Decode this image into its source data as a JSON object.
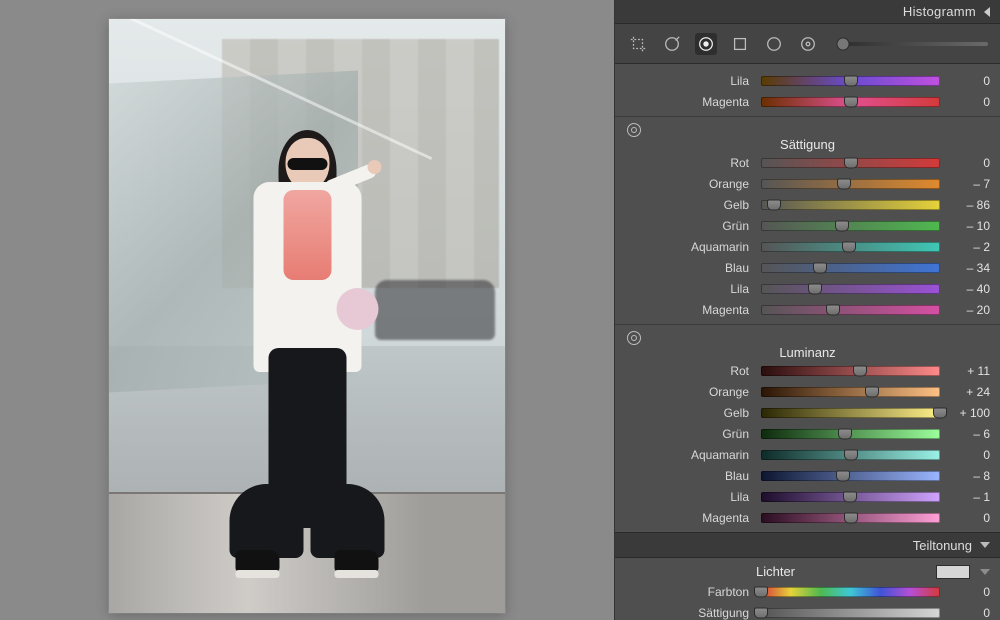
{
  "header": {
    "histogram": "Histogramm"
  },
  "top_group": {
    "rows": [
      {
        "key": "lila",
        "label": "Lila",
        "value": 0,
        "grad": [
          "#5a3c00",
          "#6a4cd0",
          "#c050e0"
        ]
      },
      {
        "key": "magenta",
        "label": "Magenta",
        "value": 0,
        "grad": [
          "#6a2f00",
          "#e05090",
          "#d43a3a"
        ]
      }
    ]
  },
  "saturation": {
    "title": "Sättigung",
    "rows": [
      {
        "key": "rot",
        "label": "Rot",
        "value": 0,
        "grad": [
          "#555",
          "#d43a3a"
        ]
      },
      {
        "key": "orange",
        "label": "Orange",
        "value": -7,
        "grad": [
          "#555",
          "#e08a2e"
        ]
      },
      {
        "key": "gelb",
        "label": "Gelb",
        "value": -86,
        "grad": [
          "#555",
          "#e6d23a"
        ]
      },
      {
        "key": "gruen",
        "label": "Grün",
        "value": -10,
        "grad": [
          "#555",
          "#4fb94f"
        ]
      },
      {
        "key": "aquamarin",
        "label": "Aquamarin",
        "value": -2,
        "grad": [
          "#555",
          "#3fc7b6"
        ]
      },
      {
        "key": "blau",
        "label": "Blau",
        "value": -34,
        "grad": [
          "#555",
          "#3f74d6"
        ]
      },
      {
        "key": "lila",
        "label": "Lila",
        "value": -40,
        "grad": [
          "#555",
          "#9a52d6"
        ]
      },
      {
        "key": "magenta",
        "label": "Magenta",
        "value": -20,
        "grad": [
          "#555",
          "#d64fa3"
        ]
      }
    ]
  },
  "luminance": {
    "title": "Luminanz",
    "rows": [
      {
        "key": "rot",
        "label": "Rot",
        "value": 11,
        "grad": [
          "#2a0d0d",
          "#ff8a8a"
        ]
      },
      {
        "key": "orange",
        "label": "Orange",
        "value": 24,
        "grad": [
          "#2a1505",
          "#ffc184"
        ]
      },
      {
        "key": "gelb",
        "label": "Gelb",
        "value": 100,
        "grad": [
          "#2a2705",
          "#fff08a"
        ]
      },
      {
        "key": "gruen",
        "label": "Grün",
        "value": -6,
        "grad": [
          "#0d2a0d",
          "#9bff9b"
        ]
      },
      {
        "key": "aquamarin",
        "label": "Aquamarin",
        "value": 0,
        "grad": [
          "#0d2a27",
          "#99f1e6"
        ]
      },
      {
        "key": "blau",
        "label": "Blau",
        "value": -8,
        "grad": [
          "#0d1630",
          "#9ab6ff"
        ]
      },
      {
        "key": "lila",
        "label": "Lila",
        "value": -1,
        "grad": [
          "#1d0d2a",
          "#cfa3ff"
        ]
      },
      {
        "key": "magenta",
        "label": "Magenta",
        "value": 0,
        "grad": [
          "#2a0d20",
          "#ff9fd6"
        ]
      }
    ]
  },
  "splittoning": {
    "section": "Teiltonung",
    "lichter_label": "Lichter",
    "rows": [
      {
        "key": "farbton",
        "label": "Farbton",
        "value": 0,
        "grad": [
          "#d43a3a",
          "#e6d23a",
          "#4fb94f",
          "#3fc7d6",
          "#3f54d6",
          "#b54fd6",
          "#d43a3a"
        ],
        "knob_pos": 0
      },
      {
        "key": "saettigung",
        "label": "Sättigung",
        "value": 0,
        "grad": [
          "#555",
          "#d6d6d6"
        ],
        "knob_pos": 0
      }
    ]
  }
}
